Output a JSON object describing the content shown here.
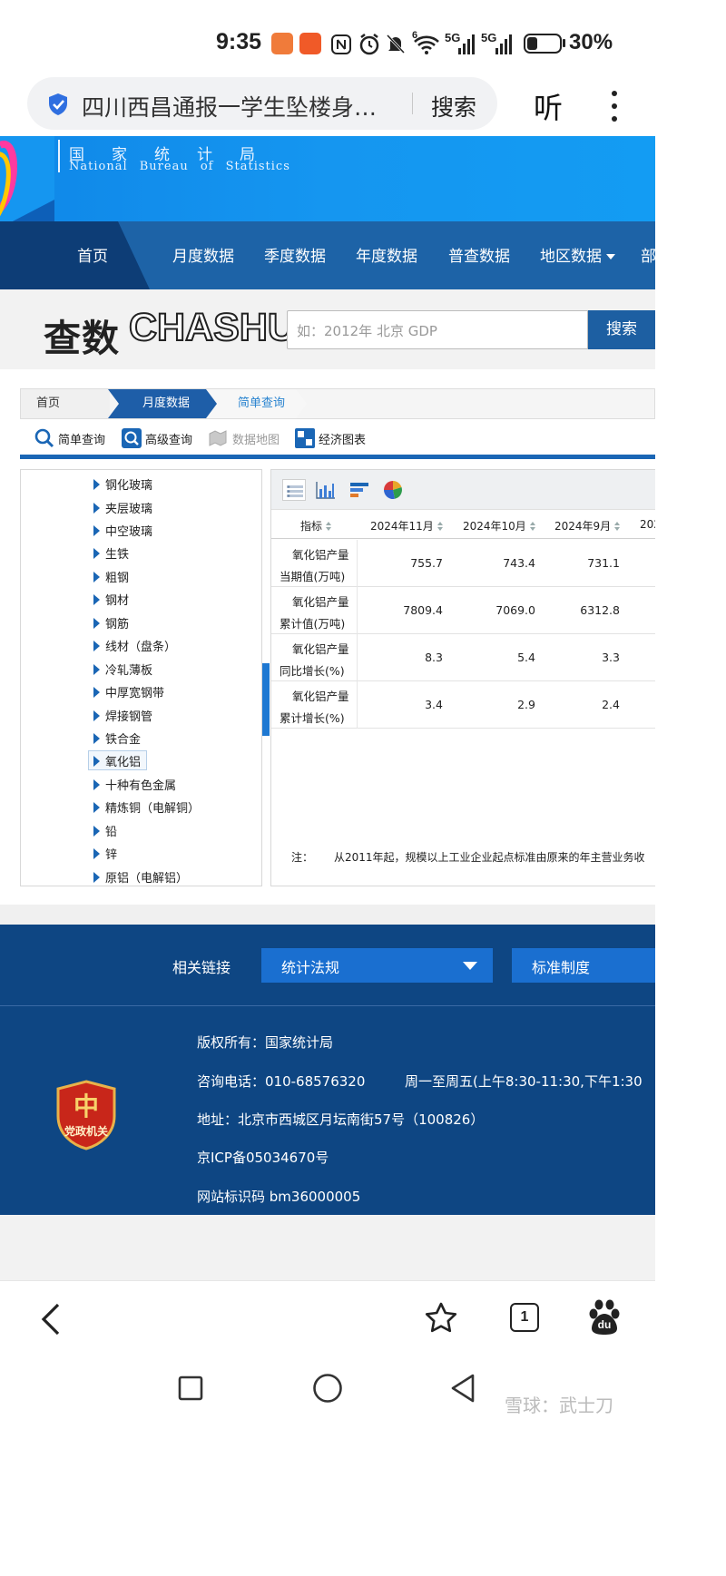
{
  "status_bar": {
    "time": "9:35",
    "network_1": "5G",
    "network_2": "5G",
    "wifi_badge": "6",
    "battery_percent": "30%",
    "icons": [
      "shield-app-icon",
      "grid-app-icon",
      "nfc-icon",
      "alarm-icon",
      "mute-icon",
      "wifi-icon",
      "signal-icon",
      "battery-icon"
    ]
  },
  "browser": {
    "page_title": "四川西昌通报一学生坠楼身…",
    "search_label": "搜索",
    "listen_label": "听"
  },
  "site": {
    "org_name_cn": "国家统计局",
    "org_name_en": "National Bureau of Statistics",
    "nav": [
      "首页",
      "月度数据",
      "季度数据",
      "年度数据",
      "普查数据",
      "地区数据",
      "部"
    ],
    "chashu_cn": "查数",
    "chashu_en": "CHASHU",
    "search_placeholder": "如：2012年 北京 GDP",
    "search_button": "搜索"
  },
  "breadcrumb": [
    "首页",
    "月度数据",
    "简单查询"
  ],
  "query_tools": [
    {
      "label": "简单查询",
      "icon": "search-icon"
    },
    {
      "label": "高级查询",
      "icon": "advanced-search-icon"
    },
    {
      "label": "数据地图",
      "icon": "map-icon"
    },
    {
      "label": "经济图表",
      "icon": "chart-icon"
    }
  ],
  "tree_items": [
    "钢化玻璃",
    "夹层玻璃",
    "中空玻璃",
    "生铁",
    "粗钢",
    "钢材",
    "钢筋",
    "线材（盘条）",
    "冷轧薄板",
    "中厚宽钢带",
    "焊接钢管",
    "铁合金",
    "氧化铝",
    "十种有色金属",
    "精炼铜（电解铜）",
    "铅",
    "锌",
    "原铝（电解铝）"
  ],
  "selected_tree_item": "氧化铝",
  "table": {
    "view_icons": [
      "table-view-icon",
      "bar-chart-icon",
      "horizontal-bar-icon",
      "pie-chart-icon"
    ],
    "headers": [
      "指标",
      "2024年11月",
      "2024年10月",
      "2024年9月",
      "202"
    ],
    "rows": [
      {
        "label_line1": "氧化铝产量",
        "label_line2": "当期值(万吨)",
        "values": [
          "755.7",
          "743.4",
          "731.1"
        ]
      },
      {
        "label_line1": "氧化铝产量",
        "label_line2": "累计值(万吨)",
        "values": [
          "7809.4",
          "7069.0",
          "6312.8"
        ]
      },
      {
        "label_line1": "氧化铝产量",
        "label_line2": "同比增长(%)",
        "values": [
          "8.3",
          "5.4",
          "3.3"
        ]
      },
      {
        "label_line1": "氧化铝产量",
        "label_line2": "累计增长(%)",
        "values": [
          "3.4",
          "2.9",
          "2.4"
        ]
      }
    ],
    "note_label": "注：",
    "note_text": "从2011年起，规模以上工业企业起点标准由原来的年主营业务收"
  },
  "footer": {
    "links_label": "相关链接",
    "select_1": "统计法规",
    "select_2": "标准制度",
    "copyright": "版权所有：国家统计局",
    "phone": "咨询电话：010-68576320",
    "hours": "周一至周五(上午8:30-11:30,下午1:30",
    "address": "地址：北京市西城区月坛南街57号（100826）",
    "icp": "京ICP备05034670号",
    "site_code": "网站标识码 bm36000005",
    "badge_text": "党政机关",
    "badge_glyph": "中"
  },
  "bottom_bar": {
    "tab_count": "1",
    "baidu_label": "du"
  },
  "watermark": "雪球：武士刀",
  "colors": {
    "header_blue": "#1596f0",
    "nav_blue": "#1d63a7",
    "nav_dark": "#0d3d76",
    "footer_blue": "#0e4683",
    "accent": "#1a66b5"
  }
}
